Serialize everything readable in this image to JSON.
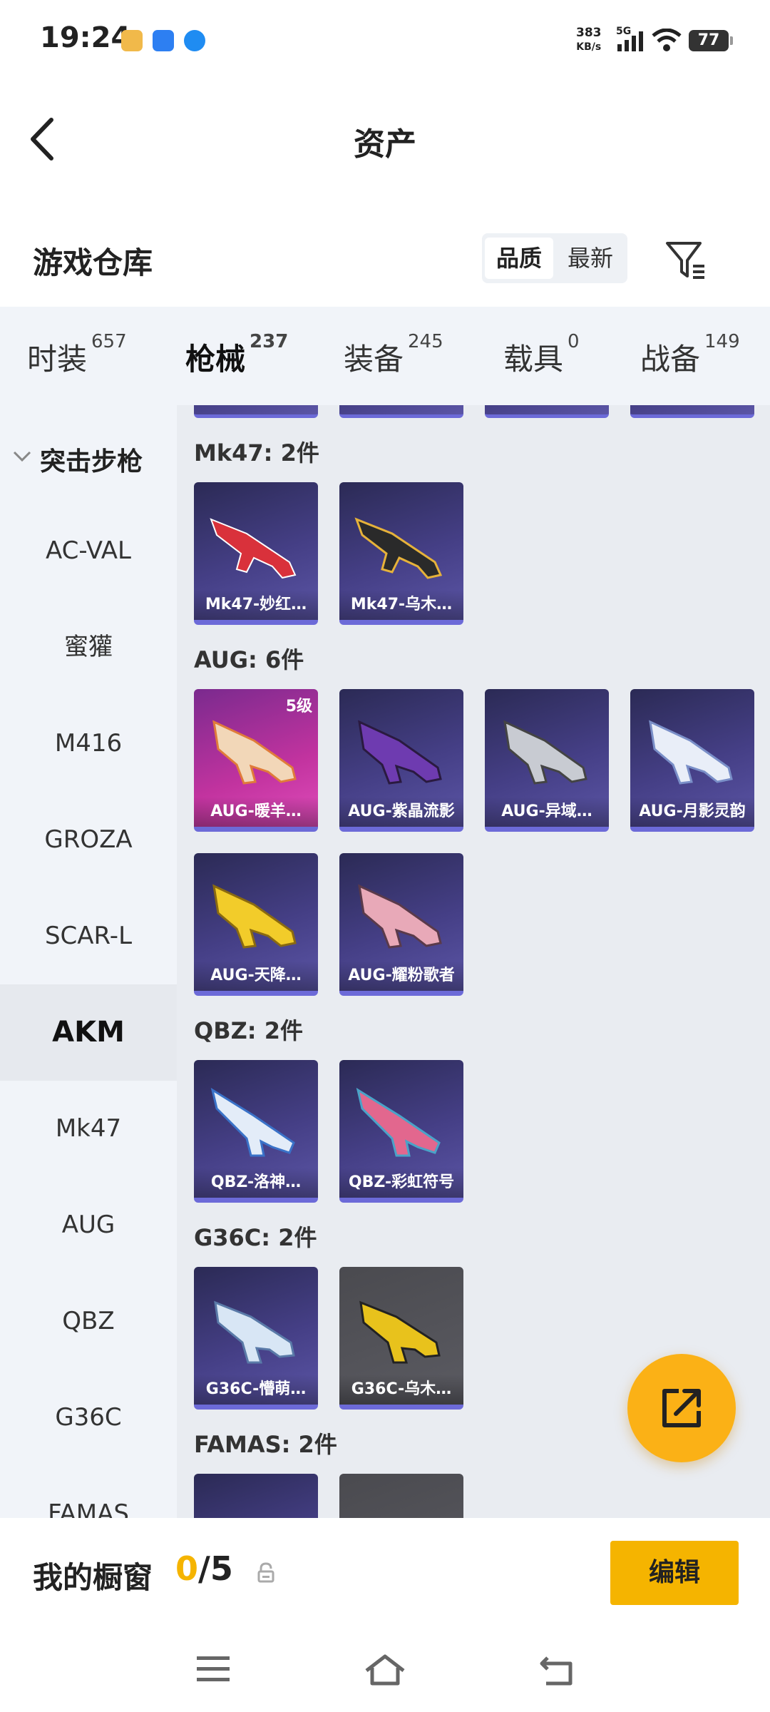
{
  "status_bar": {
    "time": "19:24",
    "net_speed": "383",
    "net_unit": "KB/s",
    "network": "5G",
    "battery": "77"
  },
  "header": {
    "title": "资产"
  },
  "warehouse": {
    "label": "游戏仓库",
    "sort_quality": "品质",
    "sort_newest": "最新"
  },
  "tabs": [
    {
      "label": "时装",
      "count": "657"
    },
    {
      "label": "枪械",
      "count": "237"
    },
    {
      "label": "装备",
      "count": "245"
    },
    {
      "label": "载具",
      "count": "0"
    },
    {
      "label": "战备",
      "count": "149"
    }
  ],
  "sidebar": {
    "category": "突击步枪",
    "items": [
      "AC-VAL",
      "蜜獾",
      "M416",
      "GROZA",
      "SCAR-L",
      "AKM",
      "Mk47",
      "AUG",
      "QBZ",
      "G36C",
      "FAMAS"
    ],
    "selected": "AKM"
  },
  "groups": [
    {
      "title": "Mk47: 2件",
      "items": [
        {
          "name": "Mk47-妙红…"
        },
        {
          "name": "Mk47-乌木…"
        }
      ]
    },
    {
      "title": "AUG: 6件",
      "items": [
        {
          "name": "AUG-暖羊…",
          "level": "5级"
        },
        {
          "name": "AUG-紫晶流影"
        },
        {
          "name": "AUG-异域…"
        },
        {
          "name": "AUG-月影灵韵"
        },
        {
          "name": "AUG-天降…"
        },
        {
          "name": "AUG-耀粉歌者"
        }
      ]
    },
    {
      "title": "QBZ: 2件",
      "items": [
        {
          "name": "QBZ-洛神…"
        },
        {
          "name": "QBZ-彩虹符号"
        }
      ]
    },
    {
      "title": "G36C: 2件",
      "items": [
        {
          "name": "G36C-懵萌…"
        },
        {
          "name": "G36C-乌木…"
        }
      ]
    },
    {
      "title": "FAMAS: 2件",
      "items": []
    }
  ],
  "showcase": {
    "label": "我的橱窗",
    "current": "0",
    "total": "/5",
    "edit_label": "编辑"
  },
  "colors": {
    "accent": "#f5b400",
    "card_bg": "#3f3a7e",
    "card_border": "#6c6ad8",
    "pink_card": "#c2339f"
  }
}
